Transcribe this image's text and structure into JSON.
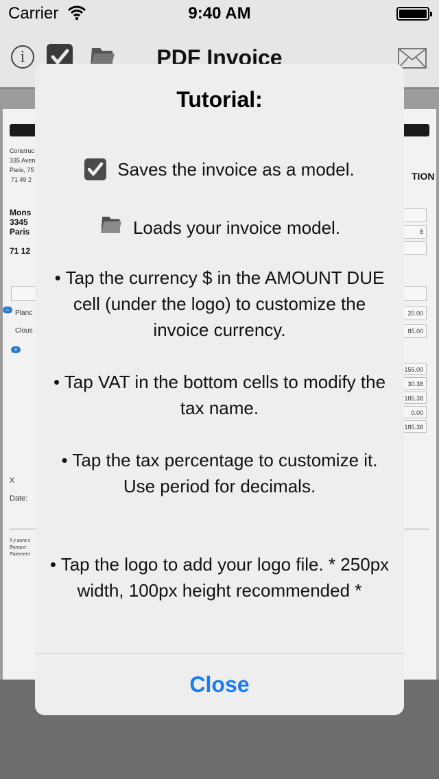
{
  "status_bar": {
    "carrier": "Carrier",
    "time": "9:40 AM"
  },
  "nav_bar": {
    "title": "PDF Invoice",
    "info_label": "i"
  },
  "invoice_preview": {
    "sender_lines": [
      "Construc",
      "335 Aven",
      "Paris, 75",
      "71 49 2"
    ],
    "client_lines": [
      "Mons",
      "3345",
      "Paris"
    ],
    "client_phone": "71 12",
    "logo_text": "TION",
    "item_rows": [
      "Planc",
      "Clous"
    ],
    "item_amounts": [
      "20.00",
      "85.00"
    ],
    "totals": [
      "155.00",
      "30.38",
      "185.38",
      "0.00",
      "185.38"
    ],
    "phone_right": "8",
    "sign_x": "X",
    "sign_date": "Date:",
    "footer_lines": [
      "Il y aura c",
      "Banque :",
      "Paiement"
    ]
  },
  "tutorial": {
    "title": "Tutorial:",
    "save_model": "Saves the invoice as a model.",
    "load_model": "Loads your invoice model.",
    "tip_currency": "• Tap the currency $ in the AMOUNT DUE cell (under the logo) to customize the invoice currency.",
    "tip_vat": "• Tap VAT in the bottom cells to modify the tax name.",
    "tip_tax": "• Tap the tax percentage to customize it. Use period for decimals.",
    "tip_logo": "• Tap the logo to add your logo file. * 250px width, 100px height recommended *",
    "close_label": "Close"
  },
  "colors": {
    "accent": "#1a7cf5",
    "alert_bg": "#eeeeee",
    "dim": "#6b6b6b"
  },
  "icons": [
    "wifi-icon",
    "battery-icon",
    "info-icon",
    "checkbox-icon",
    "folder-icon",
    "mail-icon"
  ]
}
